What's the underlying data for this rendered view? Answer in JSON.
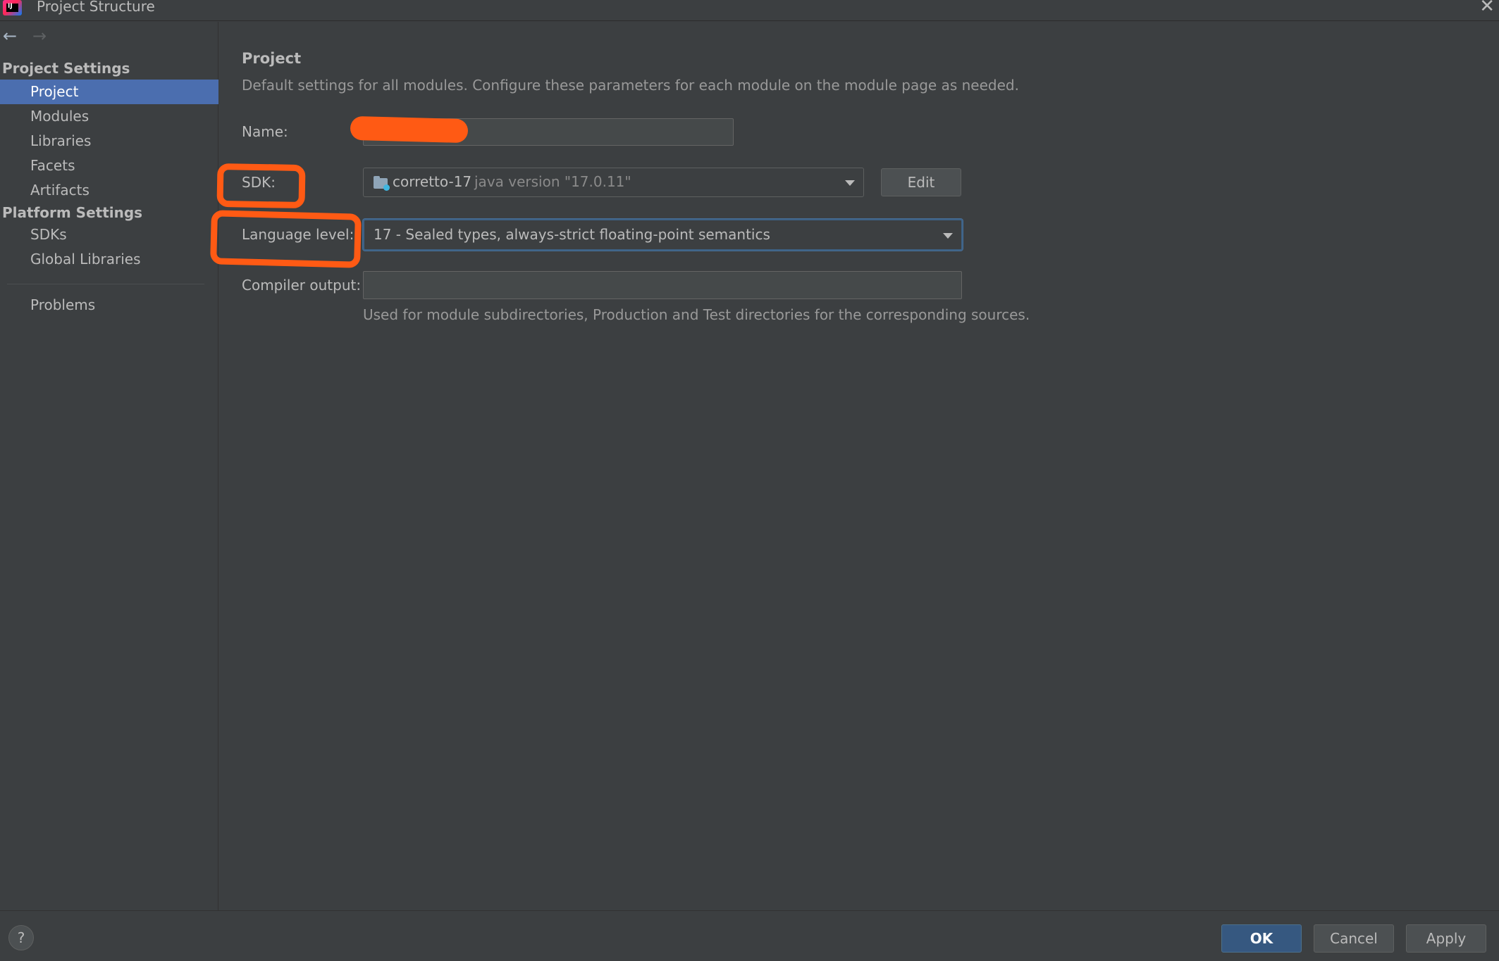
{
  "window": {
    "title": "Project Structure",
    "logo_text": "IJ",
    "close_glyph": "✕"
  },
  "nav": {
    "back_glyph": "←",
    "forward_glyph": "→"
  },
  "sidebar": {
    "project_settings_heading": "Project Settings",
    "platform_settings_heading": "Platform Settings",
    "items": [
      {
        "label": "Project"
      },
      {
        "label": "Modules"
      },
      {
        "label": "Libraries"
      },
      {
        "label": "Facets"
      },
      {
        "label": "Artifacts"
      },
      {
        "label": "SDKs"
      },
      {
        "label": "Global Libraries"
      },
      {
        "label": "Problems"
      }
    ],
    "selected": "Project"
  },
  "main": {
    "title": "Project",
    "description": "Default settings for all modules. Configure these parameters for each module on the module page as needed.",
    "name_label": "Name:",
    "name_value": "",
    "sdk_label": "SDK:",
    "sdk_name": "corretto-17",
    "sdk_version": "java version \"17.0.11\"",
    "sdk_edit_button": "Edit",
    "language_level_label": "Language level:",
    "language_level_value": "17 - Sealed types, always-strict floating-point semantics",
    "compiler_output_label": "Compiler output:",
    "compiler_output_value": "",
    "compiler_output_hint": "Used for module subdirectories, Production and Test directories for the corresponding sources."
  },
  "footer": {
    "help_label": "?",
    "ok_label": "OK",
    "cancel_label": "Cancel",
    "apply_label": "Apply"
  },
  "colors": {
    "background": "#3c3f41",
    "selection": "#4b6eaf",
    "default_button": "#365880",
    "annotation": "#ff5a14"
  },
  "icons": {
    "sdk": "folder-icon",
    "browse": "folder-open-icon",
    "dropdown": "chevron-down-icon"
  }
}
